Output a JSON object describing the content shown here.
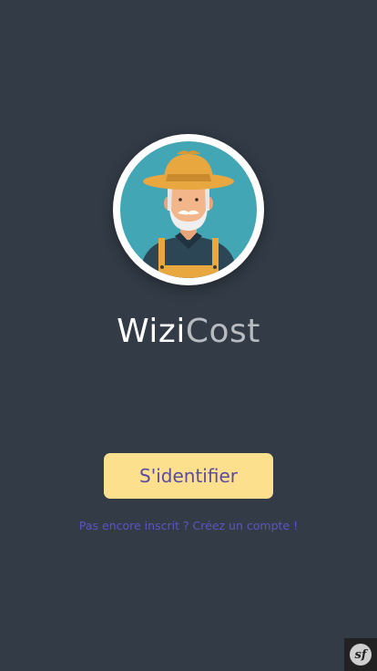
{
  "app": {
    "brand_part1": "Wizi",
    "brand_part2": "Cost",
    "avatar_icon": "farmer-avatar-icon"
  },
  "actions": {
    "login_label": "S'identifier",
    "signup_label": "Pas encore inscrit ? Créez un compte !"
  },
  "debug_toolbar": {
    "icon": "symfony-icon",
    "glyph": "sf"
  },
  "colors": {
    "background": "#323b46",
    "button_bg": "#fde08d",
    "button_text": "#5a4aa0",
    "link": "#5b55c6",
    "avatar_bg": "#43a6b4"
  }
}
